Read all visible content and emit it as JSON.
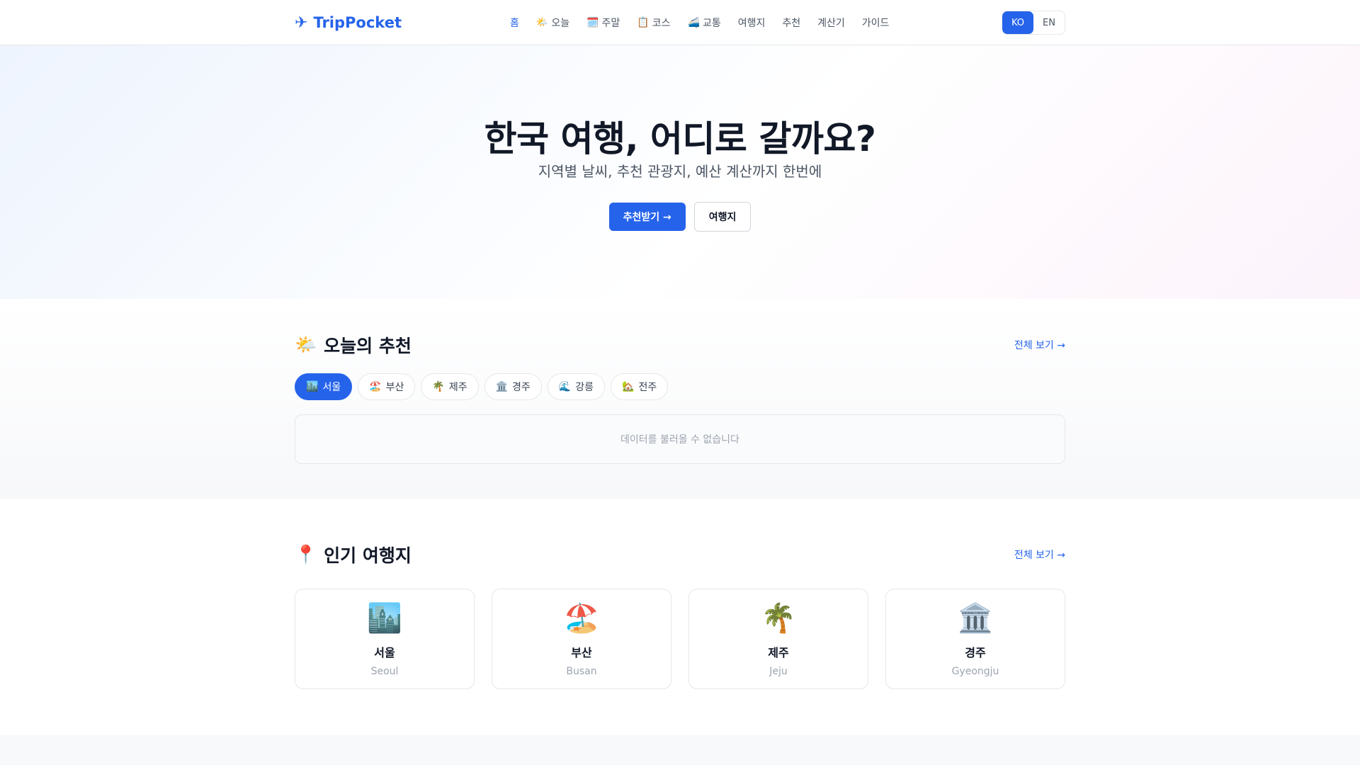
{
  "nav": {
    "brand_icon": "✈",
    "brand": "TripPocket",
    "items": [
      {
        "icon": "",
        "label": "홈",
        "active": true
      },
      {
        "icon": "🌤️",
        "label": "오늘"
      },
      {
        "icon": "🗓️",
        "label": "주말"
      },
      {
        "icon": "📋",
        "label": "코스"
      },
      {
        "icon": "🚄",
        "label": "교통"
      },
      {
        "icon": "",
        "label": "여행지"
      },
      {
        "icon": "",
        "label": "추천"
      },
      {
        "icon": "",
        "label": "계산기"
      },
      {
        "icon": "",
        "label": "가이드"
      }
    ],
    "lang": {
      "ko": "KO",
      "en": "EN"
    }
  },
  "hero": {
    "title": "한국 여행, 어디로 갈까요?",
    "subtitle": "지역별 날씨, 추천 관광지, 예산 계산까지 한번에",
    "primary_btn": "추천받기 →",
    "secondary_btn": "여행지"
  },
  "today": {
    "icon": "🌤️",
    "title": "오늘의 추천",
    "see_all": "전체 보기 →",
    "chips": [
      {
        "icon": "🏙️",
        "label": "서울",
        "active": true
      },
      {
        "icon": "🏖️",
        "label": "부산"
      },
      {
        "icon": "🌴",
        "label": "제주"
      },
      {
        "icon": "🏛️",
        "label": "경주"
      },
      {
        "icon": "🌊",
        "label": "강릉"
      },
      {
        "icon": "🏡",
        "label": "전주"
      }
    ],
    "empty_message": "데이터를 불러올 수 없습니다"
  },
  "popular": {
    "icon": "📍",
    "title": "인기 여행지",
    "see_all": "전체 보기 →",
    "cards": [
      {
        "icon": "🏙️",
        "name": "서울",
        "en": "Seoul"
      },
      {
        "icon": "🏖️",
        "name": "부산",
        "en": "Busan"
      },
      {
        "icon": "🌴",
        "name": "제주",
        "en": "Jeju"
      },
      {
        "icon": "🏛️",
        "name": "경주",
        "en": "Gyeongju"
      }
    ]
  },
  "colors": {
    "accent": "#2563eb",
    "text": "#111827",
    "muted": "#9ca3af",
    "border": "#e5e7eb"
  }
}
